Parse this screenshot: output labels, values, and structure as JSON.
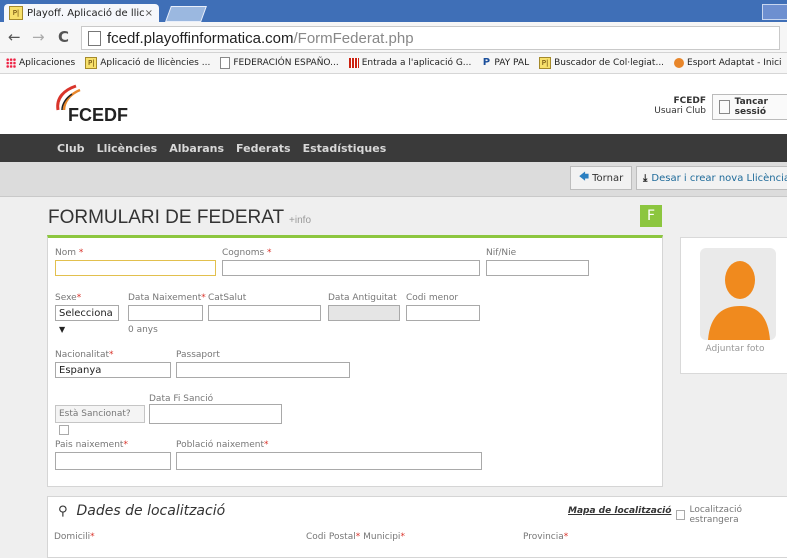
{
  "browser": {
    "tab_title": "Playoff. Aplicació de llicència",
    "tab_icon": "P|",
    "close": "×",
    "url_host": "fcedf.playoffinformatica.com",
    "url_path": "/FormFederat.php",
    "nav_back": "←",
    "nav_forward": "→",
    "nav_reload": "C",
    "bookmarks": [
      {
        "icon": "apps-icon",
        "label": "Aplicaciones"
      },
      {
        "icon": "playoff-icon",
        "label": "Aplicació de llicències ..."
      },
      {
        "icon": "page-icon",
        "label": "FEDERACIÓN ESPAÑO..."
      },
      {
        "icon": "red-bars-icon",
        "label": "Entrada a l'aplicació G..."
      },
      {
        "icon": "paypal-icon",
        "label": "PAY PAL"
      },
      {
        "icon": "playoff-icon",
        "label": "Buscador de Col·legiat..."
      },
      {
        "icon": "esport-icon",
        "label": "Esport Adaptat - Inici"
      }
    ]
  },
  "header": {
    "logo_text": "FCEDF",
    "user_name": "FCEDF",
    "user_role": "Usuari Club",
    "logout": "Tancar sessió"
  },
  "menu": [
    "Club",
    "Llicències",
    "Albarans",
    "Federats",
    "Estadístiques"
  ],
  "actions": {
    "back": "Tornar",
    "save": "Desar i crear nova Llicència"
  },
  "form": {
    "title": "FORMULARI DE FEDERAT",
    "title_suffix": "+info",
    "badge": "F",
    "nom": "Nom",
    "cognoms": "Cognoms",
    "nif": "Nif/Nie",
    "sexe": "Sexe",
    "sexe_value": "Selecciona",
    "data_naixement": "Data Naixement",
    "catsalut": "CatSalut",
    "data_antiguitat": "Data Antiguitat",
    "codi_menor": "Codi menor",
    "age": "0 anys",
    "nacionalitat": "Nacionalitat",
    "nacionalitat_value": "Espanya",
    "passaport": "Passaport",
    "data_fi_sancio": "Data Fi Sanció",
    "sancionat": "Està Sancionat?",
    "pais_naixement": "Pais naixement",
    "poblacio_naixement": "Població naixement",
    "required_mark": "*",
    "photo_label": "Adjuntar foto"
  },
  "location": {
    "title": "Dades de localització",
    "map_link": "Mapa de localització",
    "foreign": "Localització estrangera",
    "domicili": "Domicili",
    "codi_postal": "Codi Postal",
    "municipi": "Municipi",
    "provincia": "Provincia"
  },
  "colors": {
    "accent_green": "#8cc63f",
    "menu_bg": "#3a3a3a",
    "chrome_blue": "#3f6fb7",
    "required_red": "#d9342b"
  }
}
